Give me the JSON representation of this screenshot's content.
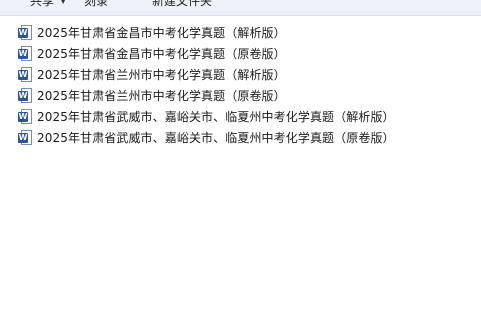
{
  "toolbar": {
    "share_label": "共享",
    "burn_label": "刻录",
    "new_folder_label": "新建文件夹"
  },
  "icons": {
    "file_icon": "word-doc-icon",
    "file_icon_letter": "W",
    "word_blue": "#2a5699"
  },
  "files": [
    {
      "name": "2025年甘肃省金昌市中考化学真题（解析版）"
    },
    {
      "name": "2025年甘肃省金昌市中考化学真题（原卷版）"
    },
    {
      "name": "2025年甘肃省兰州市中考化学真题（解析版）"
    },
    {
      "name": "2025年甘肃省兰州市中考化学真题（原卷版）"
    },
    {
      "name": "2025年甘肃省武威市、嘉峪关市、临夏州中考化学真题（解析版）"
    },
    {
      "name": "2025年甘肃省武威市、嘉峪关市、临夏州中考化学真题（原卷版）"
    }
  ]
}
